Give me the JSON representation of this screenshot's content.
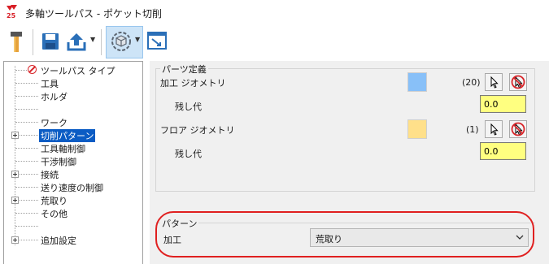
{
  "window": {
    "title": "多軸ツールパス - ポケット切削"
  },
  "toolbar": {
    "items": [
      "tool-icon",
      "save-icon",
      "export-icon",
      "view-3d-icon",
      "window-switch-icon"
    ]
  },
  "tree": {
    "items": [
      {
        "label": "ツールパス タイプ",
        "expandable": false,
        "icon": "forbid-icon"
      },
      {
        "label": "工具",
        "expandable": false
      },
      {
        "label": "ホルダ",
        "expandable": false
      },
      {
        "label": "",
        "expandable": false
      },
      {
        "label": "ワーク",
        "expandable": false
      },
      {
        "label": "切削パターン",
        "expandable": true,
        "selected": true
      },
      {
        "label": "工具軸制御",
        "expandable": false
      },
      {
        "label": "干渉制御",
        "expandable": false
      },
      {
        "label": "接続",
        "expandable": true
      },
      {
        "label": "送り速度の制御",
        "expandable": false
      },
      {
        "label": "荒取り",
        "expandable": true
      },
      {
        "label": "その他",
        "expandable": false
      },
      {
        "label": "",
        "expandable": false
      },
      {
        "label": "追加設定",
        "expandable": true
      }
    ]
  },
  "parts": {
    "group_title": "パーツ定義",
    "machining_geometry": {
      "label": "加工 ジオメトリ",
      "count": "(20)",
      "color": "#88c0f8",
      "stock_label": "残し代",
      "stock_value": "0.0"
    },
    "floor_geometry": {
      "label": "フロア ジオメトリ",
      "count": "(1)",
      "color": "#ffe08a",
      "stock_label": "残し代",
      "stock_value": "0.0"
    }
  },
  "pattern": {
    "group_title": "パターン",
    "machining_label": "加工",
    "machining_value": "荒取り"
  },
  "colors": {
    "selection": "#0b5cc4",
    "input_bg": "#ffff80",
    "highlight": "#e02020"
  }
}
